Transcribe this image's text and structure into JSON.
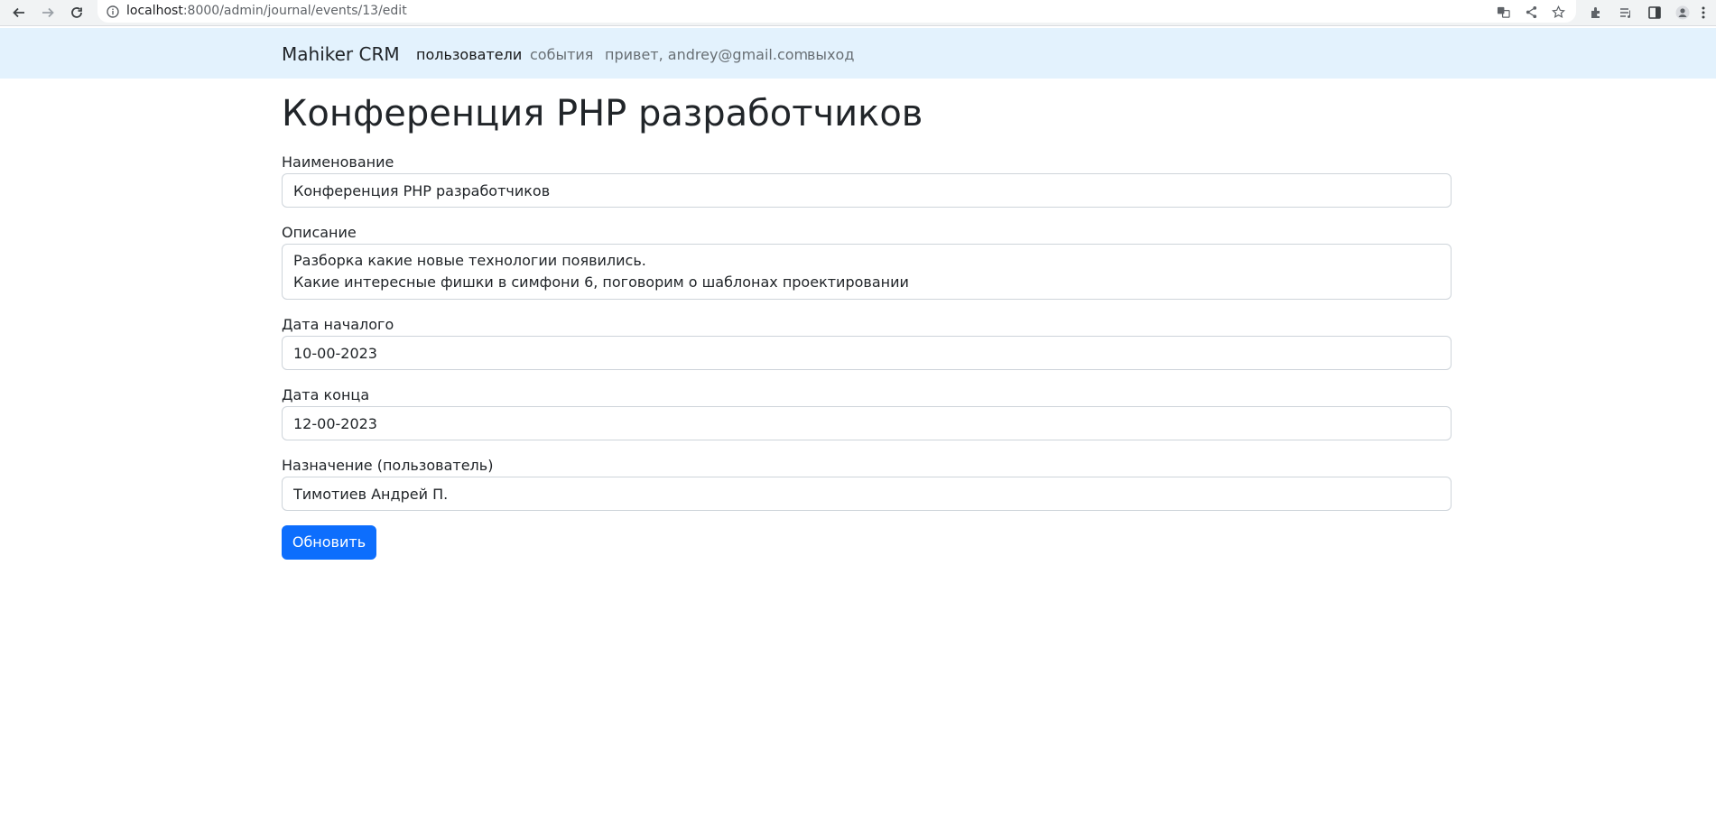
{
  "browser": {
    "url_host": "localhost",
    "url_path": ":8000/admin/journal/events/13/edit",
    "back_icon": "arrow-left-icon",
    "forward_icon": "arrow-right-icon",
    "reload_icon": "reload-icon"
  },
  "navbar": {
    "brand": "Mahiker CRM",
    "links": [
      {
        "label": "пользователи",
        "active": true
      },
      {
        "label": "события",
        "active": false
      },
      {
        "label": "привет, andrey@gmail.com",
        "active": false
      },
      {
        "label": "выход",
        "active": false
      }
    ],
    "background": "#e3f2fd"
  },
  "page": {
    "title": "Конференция PHP разработчиков"
  },
  "form": {
    "name_label": "Наименование",
    "name_value": "Конференция PHP разработчиков",
    "description_label": "Описание",
    "description_value": "Разборка какие новые технологии появились.\nКакие интересные фишки в симфони 6, поговорим о шаблонах проектировании",
    "start_label": "Дата началого",
    "start_value": "10-00-2023",
    "end_label": "Дата конца",
    "end_value": "12-00-2023",
    "assignee_label": "Назначение (пользователь)",
    "assignee_value": "Тимотиев Андрей П.",
    "submit_label": "Обновить"
  },
  "colors": {
    "primary": "#0d6efd",
    "text": "#212529",
    "border": "#ced4da"
  }
}
